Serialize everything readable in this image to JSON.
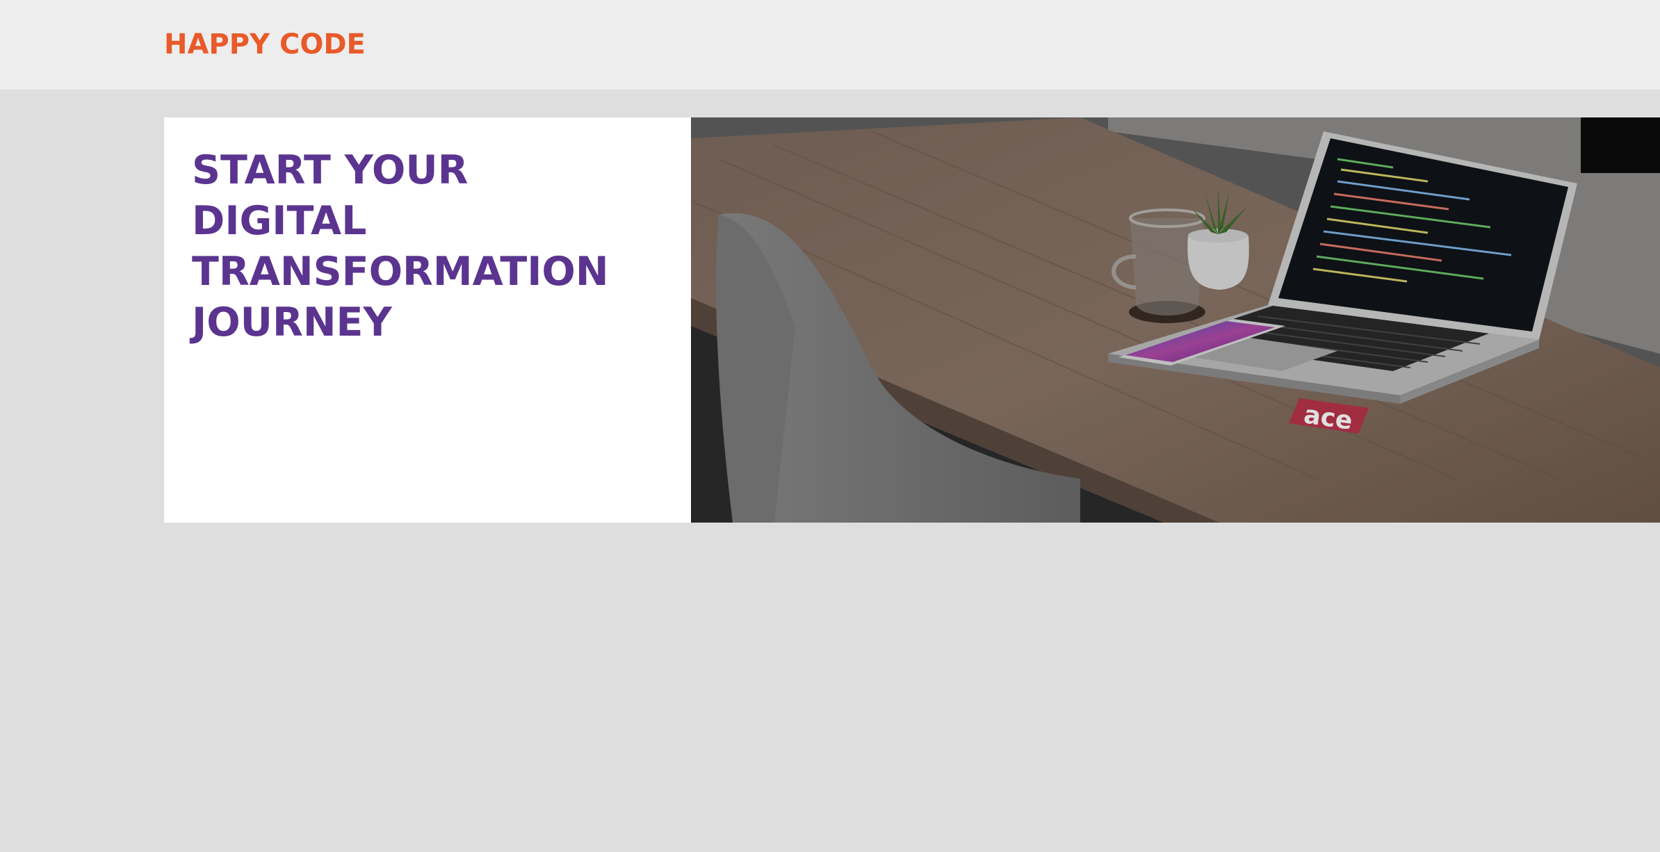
{
  "header": {
    "logo": "HAPPY CODE"
  },
  "hero": {
    "headline_lines": [
      "START YOUR",
      "DIGITAL",
      "TRANSFORMATION",
      "JOURNEY"
    ],
    "image_subject": "laptop-on-desk-photo",
    "sticker_text": "ace"
  },
  "colors": {
    "logo": "#e85a2a",
    "headline": "#5b3490",
    "page_bg": "#dedede",
    "header_bg": "#ededed"
  }
}
